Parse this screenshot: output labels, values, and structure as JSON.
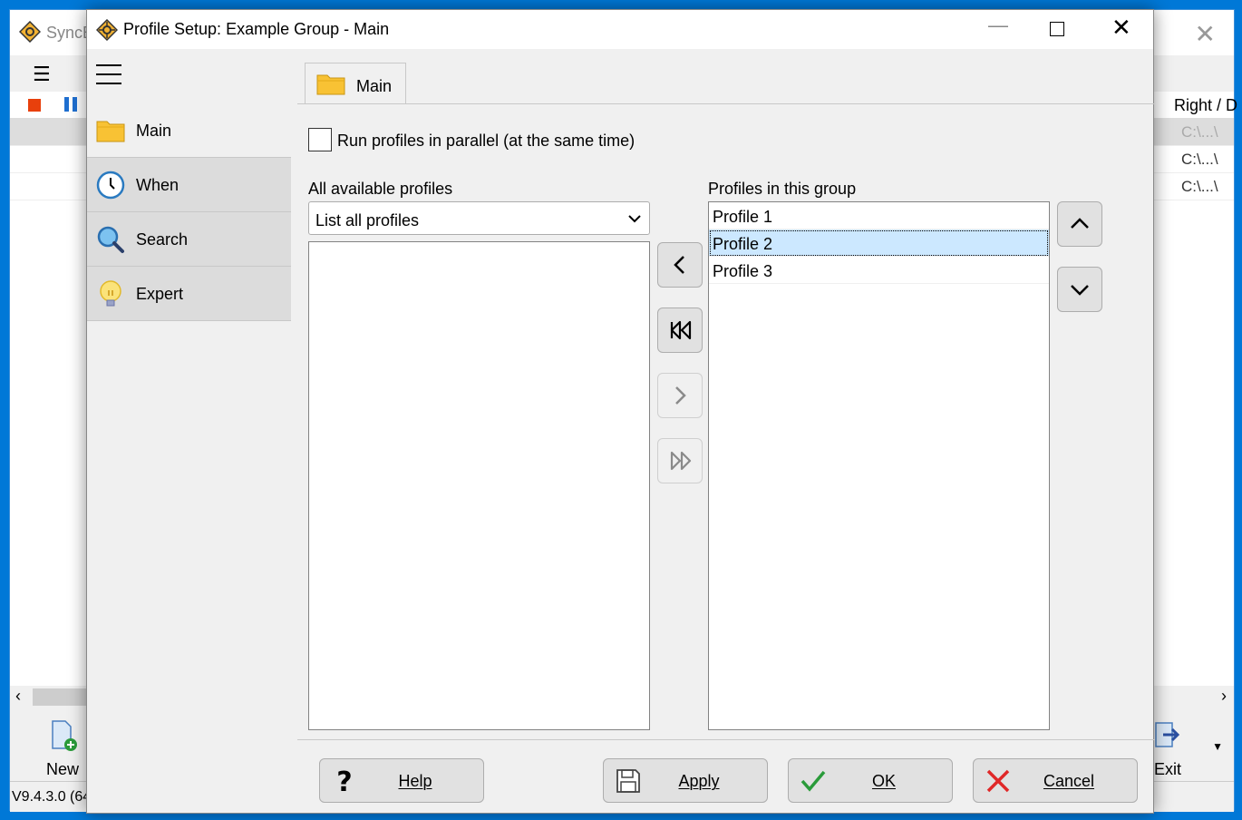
{
  "background_app": {
    "title": "SyncB",
    "column_header": "Right / D",
    "rows": [
      "C:\\...\\",
      "C:\\...\\",
      "C:\\...\\"
    ],
    "new_label": "New",
    "exit_label": "Exit",
    "version": "V9.4.3.0 (64"
  },
  "dialog": {
    "title": "Profile Setup: Example Group - Main"
  },
  "sidebar": {
    "items": [
      {
        "label": "Main",
        "icon": "folder-icon"
      },
      {
        "label": "When",
        "icon": "clock-icon"
      },
      {
        "label": "Search",
        "icon": "magnifier-icon"
      },
      {
        "label": "Expert",
        "icon": "lightbulb-icon"
      }
    ]
  },
  "tab": {
    "label": "Main"
  },
  "parallel": {
    "label": "Run profiles in parallel (at the same time)",
    "checked": false
  },
  "available": {
    "label": "All available profiles",
    "filter_value": "List all profiles",
    "items": []
  },
  "group": {
    "label": "Profiles in this group",
    "items": [
      "Profile 1",
      "Profile 2",
      "Profile 3"
    ],
    "selected_index": 1
  },
  "buttons": {
    "help": "Help",
    "apply": "Apply",
    "ok": "OK",
    "cancel": "Cancel"
  },
  "colors": {
    "selection": "#cce8ff",
    "folder": "#f8c234",
    "ok_check": "#2a9b3a",
    "cancel_x": "#e02828",
    "desktop": "#0078d7"
  }
}
